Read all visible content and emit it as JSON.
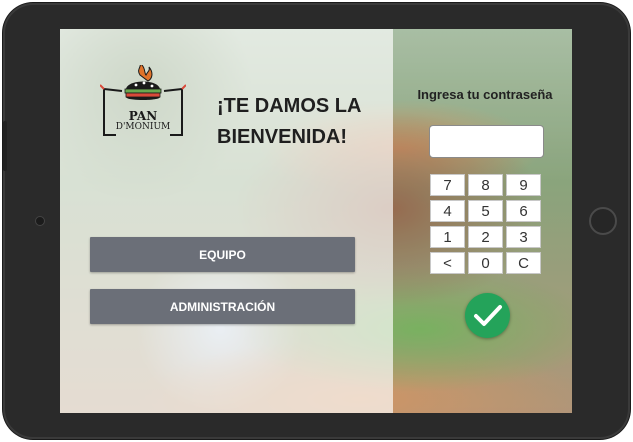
{
  "brand": {
    "line1": "PAN",
    "line2": "D'MONIUM"
  },
  "welcome": {
    "line1": "¡TE DAMOS LA",
    "line2": "BIENVENIDA!"
  },
  "buttons": {
    "team": "EQUIPO",
    "admin": "ADMINISTRACIÓN"
  },
  "password": {
    "label": "Ingresa tu contraseña",
    "value": ""
  },
  "keypad": {
    "keys": [
      "7",
      "8",
      "9",
      "4",
      "5",
      "6",
      "1",
      "2",
      "3",
      "<",
      "0",
      "C"
    ]
  },
  "colors": {
    "button_bg": "#6b6f78",
    "confirm_green": "#24a35a"
  }
}
